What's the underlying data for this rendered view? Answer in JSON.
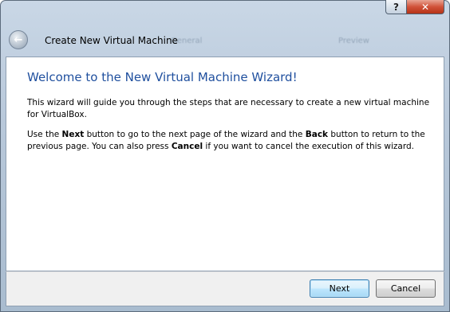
{
  "window": {
    "title": "Create New Virtual Machine",
    "help_glyph": "?",
    "close_glyph": "✕",
    "back_glyph": "←"
  },
  "background_ghost": {
    "left_text": "General",
    "right_text": "Preview"
  },
  "content": {
    "heading": "Welcome to the New Virtual Machine Wizard!",
    "paragraph1": "This wizard will guide you through the steps that are necessary to create a new virtual machine for VirtualBox.",
    "paragraph2": {
      "t1": "Use the ",
      "b1": "Next",
      "t2": " button to go to the next page of the wizard and the ",
      "b2": "Back",
      "t3": " button to return to the previous page. You can also press ",
      "b3": "Cancel",
      "t4": " if you want to cancel the execution of this wizard."
    }
  },
  "buttons": {
    "next_label": "Next",
    "cancel_label": "Cancel"
  },
  "colors": {
    "heading": "#1f4f9e",
    "close_button": "#c8452b",
    "frame": "#b8c8da"
  }
}
